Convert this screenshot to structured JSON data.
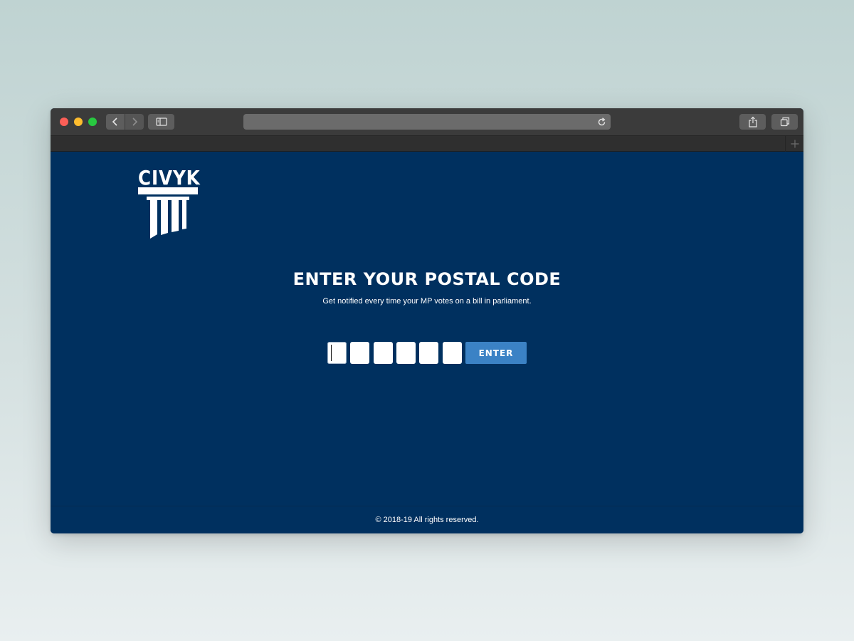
{
  "browser": {
    "traffic_lights": {
      "close": "#fc5f57",
      "minimize": "#fdbc2e",
      "zoom": "#28c840"
    },
    "toolbar_icons": [
      "back-icon",
      "forward-icon",
      "sidebar-icon",
      "reload-icon",
      "share-icon",
      "tabs-icon",
      "plus-icon"
    ]
  },
  "brand": {
    "name": "CIVYK",
    "background": "#00305f",
    "accent": "#3b82c5"
  },
  "main": {
    "title": "ENTER YOUR POSTAL CODE",
    "subtitle": "Get notified every time your MP votes on a bill in parliament.",
    "postal_code_digits": [
      "",
      "",
      "",
      "",
      "",
      ""
    ],
    "submit_label": "ENTER"
  },
  "footer": {
    "text": "© 2018-19 All rights reserved."
  }
}
